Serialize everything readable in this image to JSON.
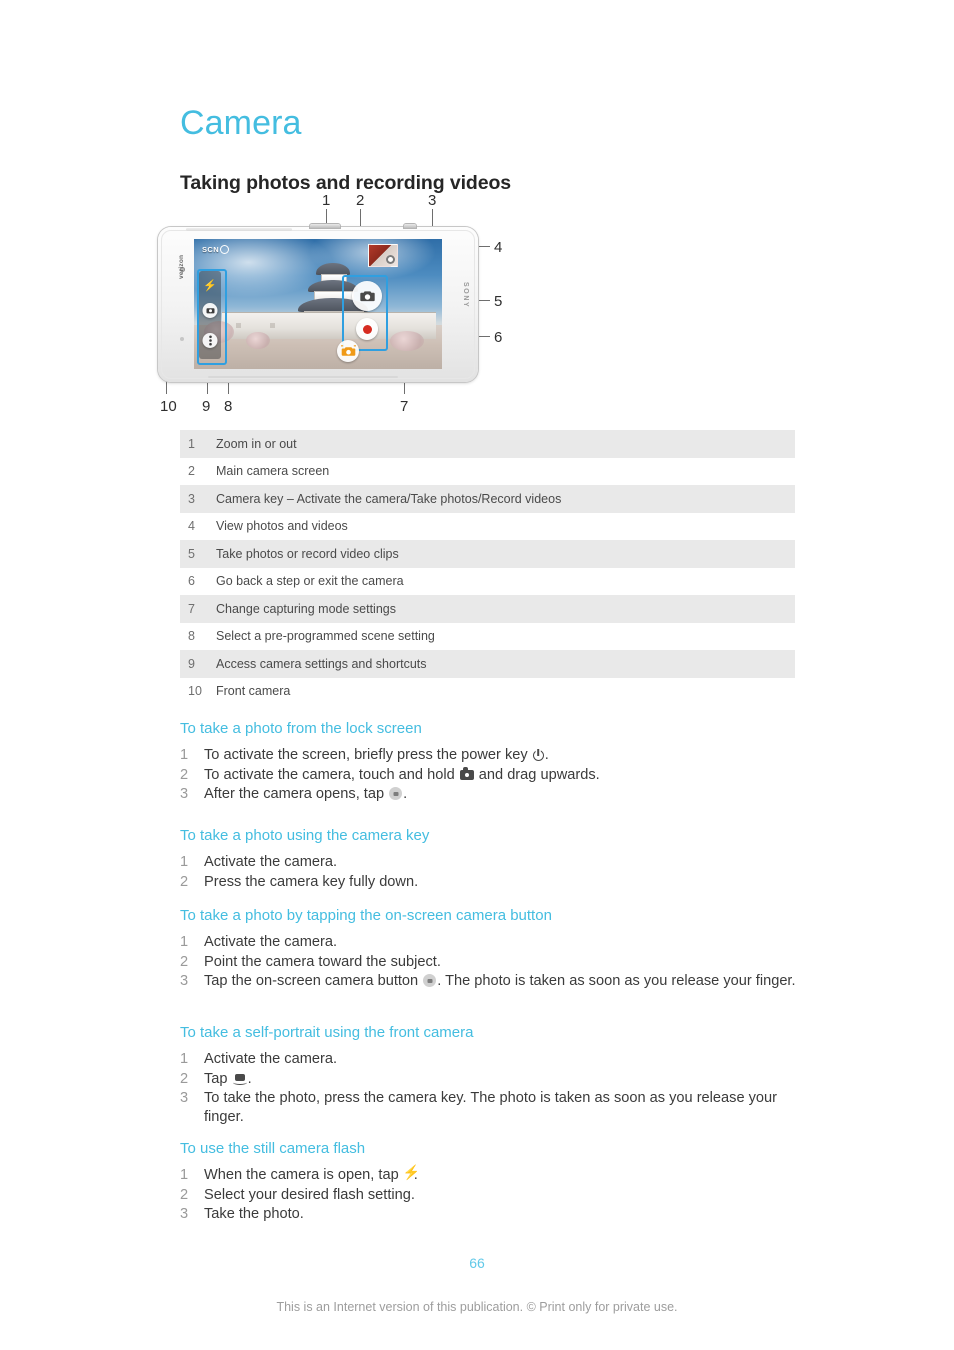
{
  "document": {
    "title": "Camera",
    "section_heading": "Taking photos and recording videos",
    "page_number": "66",
    "footer_note": "This is an Internet version of this publication. © Print only for private use.",
    "accent_color": "#44bde0",
    "highlight_color": "#2f9fe0",
    "table_row_color": "#e9e9e9"
  },
  "figure": {
    "device_brand": "SONY",
    "carrier_brand": "verizon",
    "scene_label": "SCN",
    "callouts": [
      "1",
      "2",
      "3",
      "4",
      "5",
      "6",
      "7",
      "8",
      "9",
      "10"
    ]
  },
  "legend": {
    "rows": [
      {
        "index": "1",
        "text": "Zoom in or out"
      },
      {
        "index": "2",
        "text": "Main camera screen"
      },
      {
        "index": "3",
        "text": "Camera key – Activate the camera/Take photos/Record videos"
      },
      {
        "index": "4",
        "text": "View photos and videos"
      },
      {
        "index": "5",
        "text": "Take photos or record video clips"
      },
      {
        "index": "6",
        "text": "Go back a step or exit the camera"
      },
      {
        "index": "7",
        "text": "Change capturing mode settings"
      },
      {
        "index": "8",
        "text": "Select a pre-programmed scene setting"
      },
      {
        "index": "9",
        "text": "Access camera settings and shortcuts"
      },
      {
        "index": "10",
        "text": "Front camera"
      }
    ]
  },
  "procedures": [
    {
      "id": "lock-screen",
      "title": "To take a photo from the lock screen",
      "steps": [
        {
          "num": "1",
          "before": "To activate the screen, briefly press the power key ",
          "icon": "power-icon",
          "after": "."
        },
        {
          "num": "2",
          "before": "To activate the camera, touch and hold ",
          "icon": "camera-solid-icon",
          "after": " and drag upwards."
        },
        {
          "num": "3",
          "before": "After the camera opens, tap ",
          "icon": "shutter-icon",
          "after": "."
        }
      ]
    },
    {
      "id": "camera-key",
      "title": "To take a photo using the camera key",
      "steps": [
        {
          "num": "1",
          "before": "Activate the camera.",
          "icon": "",
          "after": ""
        },
        {
          "num": "2",
          "before": "Press the camera key fully down.",
          "icon": "",
          "after": ""
        }
      ]
    },
    {
      "id": "on-screen-button",
      "title": "To take a photo by tapping the on-screen camera button",
      "steps": [
        {
          "num": "1",
          "before": "Activate the camera.",
          "icon": "",
          "after": ""
        },
        {
          "num": "2",
          "before": "Point the camera toward the subject.",
          "icon": "",
          "after": ""
        },
        {
          "num": "3",
          "before": "Tap the on-screen camera button ",
          "icon": "shutter-icon",
          "after": ". The photo is taken as soon as you release your finger."
        }
      ]
    },
    {
      "id": "self-portrait",
      "title": "To take a self-portrait using the front camera",
      "steps": [
        {
          "num": "1",
          "before": "Activate the camera.",
          "icon": "",
          "after": ""
        },
        {
          "num": "2",
          "before": "Tap ",
          "icon": "front-camera-icon",
          "after": "."
        },
        {
          "num": "3",
          "before": "To take the photo, press the camera key. The photo is taken as soon as you release your finger.",
          "icon": "",
          "after": ""
        }
      ]
    },
    {
      "id": "still-flash",
      "title": "To use the still camera flash",
      "steps": [
        {
          "num": "1",
          "before": "When the camera is open, tap ",
          "icon": "flash-icon",
          "after": "."
        },
        {
          "num": "2",
          "before": "Select your desired flash setting.",
          "icon": "",
          "after": ""
        },
        {
          "num": "3",
          "before": "Take the photo.",
          "icon": "",
          "after": ""
        }
      ]
    }
  ]
}
